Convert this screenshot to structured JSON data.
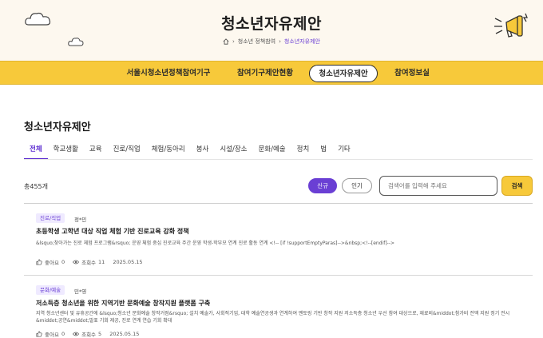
{
  "header": {
    "title": "청소년자유제안",
    "breadcrumb": [
      "청소년 정책참여",
      "청소년자유제안"
    ]
  },
  "nav": {
    "items": [
      {
        "label": "서울시청소년정책참여기구"
      },
      {
        "label": "참여기구제안현황"
      },
      {
        "label": "청소년자유제안",
        "active": true
      },
      {
        "label": "참여정보실"
      }
    ]
  },
  "section": {
    "title": "청소년자유제안",
    "tabs": [
      "전체",
      "학교생활",
      "교육",
      "진로/직업",
      "체험/동아리",
      "봉사",
      "시설/장소",
      "문화/예술",
      "정치",
      "법",
      "기타"
    ],
    "active_tab": "전체"
  },
  "toolbar": {
    "total": "총455개",
    "sort_new": "신규",
    "sort_popular": "인기",
    "search_placeholder": "검색어를 입력해 주세요",
    "search_button": "검색"
  },
  "posts": [
    {
      "category": "진로/직업",
      "author": "정*민",
      "title": "초등학생 고학년 대상 직업 체험 기반 진로교육 강화 정책",
      "summary": "&lsquo;찾아가는 진로 체험 프로그램&rsquo; 운영 체험 중심 진로교육 주간 운영 학생-학부모 연계 진로 활동 연계 <!-- [if !supportEmptyParas]-->&nbsp;<!--[endif]-->",
      "likes_label": "좋아요",
      "likes": "0",
      "views_label": "조회수",
      "views": "11",
      "date": "2025.05.15"
    },
    {
      "category": "문화/예술",
      "author": "민*영",
      "title": "저소득층 청소년을 위한 지역기반 문화예술 창작지원 플랫폼 구축",
      "summary": "지역 청소년센터 및 유휴공간에 &lsquo;청소년 문화예술 창작거점&rsquo; 설치 예술가, 사회적기업, 대학 예술연공생과 연계하여 멘토링 기반 창작 지원 저소득층 청소년 우선 참여 대상으로, 재료비&middot;참가비 전액 지원 정기 전시&middot;공연&middot;발표 기회 제공, 진로 연계 연습 기회 확대",
      "likes_label": "좋아요",
      "likes": "0",
      "views_label": "조회수",
      "views": "5",
      "date": "2025.05.15"
    }
  ],
  "colors": {
    "accent_purple": "#6a3fd4",
    "nav_yellow": "#f7c93a",
    "hero_bg": "#fdf8ef"
  }
}
